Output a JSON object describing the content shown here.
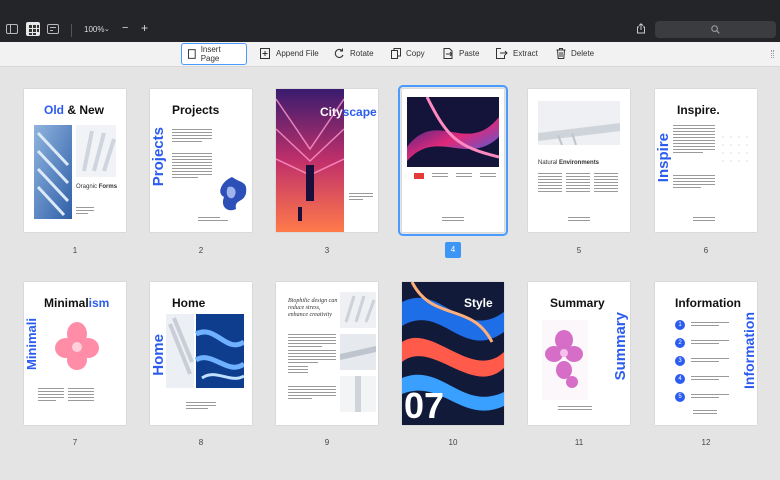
{
  "topbar": {
    "zoom": "100%",
    "zoom_caret": "⌄",
    "zoom_out": "−",
    "zoom_in": "+"
  },
  "toolbar": {
    "insert_page": "Insert Page",
    "append_file": "Append File",
    "rotate": "Rotate",
    "copy": "Copy",
    "paste": "Paste",
    "extract": "Extract",
    "delete": "Delete"
  },
  "pages": {
    "p1": {
      "number": "1",
      "title_a": "Old",
      "title_b": " & New",
      "sub_a": "Oragnic ",
      "sub_b": "Forms"
    },
    "p2": {
      "number": "2",
      "title": "Projects",
      "vertical": "Projects"
    },
    "p3": {
      "number": "3",
      "title_a": "City",
      "title_b": "scape"
    },
    "p4": {
      "number": "4"
    },
    "p5": {
      "number": "5",
      "sub_a": "Natural ",
      "sub_b": "Environments"
    },
    "p6": {
      "number": "6",
      "title": "Inspire.",
      "vertical": "Inspire"
    },
    "p7": {
      "number": "7",
      "title_a": "Minimal",
      "title_b": "ism",
      "vertical": "Minimali"
    },
    "p8": {
      "number": "8",
      "title": "Home",
      "vertical": "Home"
    },
    "p9": {
      "number": "9",
      "quote": "Biophilic design can reduce stress, enhance creativity"
    },
    "p10": {
      "number": "10",
      "title": "Style",
      "big": "07"
    },
    "p11": {
      "number": "11",
      "title": "Summary",
      "vertical": "Summary"
    },
    "p12": {
      "number": "12",
      "title": "Information",
      "vertical": "Information",
      "steps": [
        "1",
        "2",
        "3",
        "4",
        "5"
      ]
    }
  },
  "colors": {
    "accent": "#2b5cf0",
    "selection": "#4a9bff",
    "topbar": "#242528"
  }
}
